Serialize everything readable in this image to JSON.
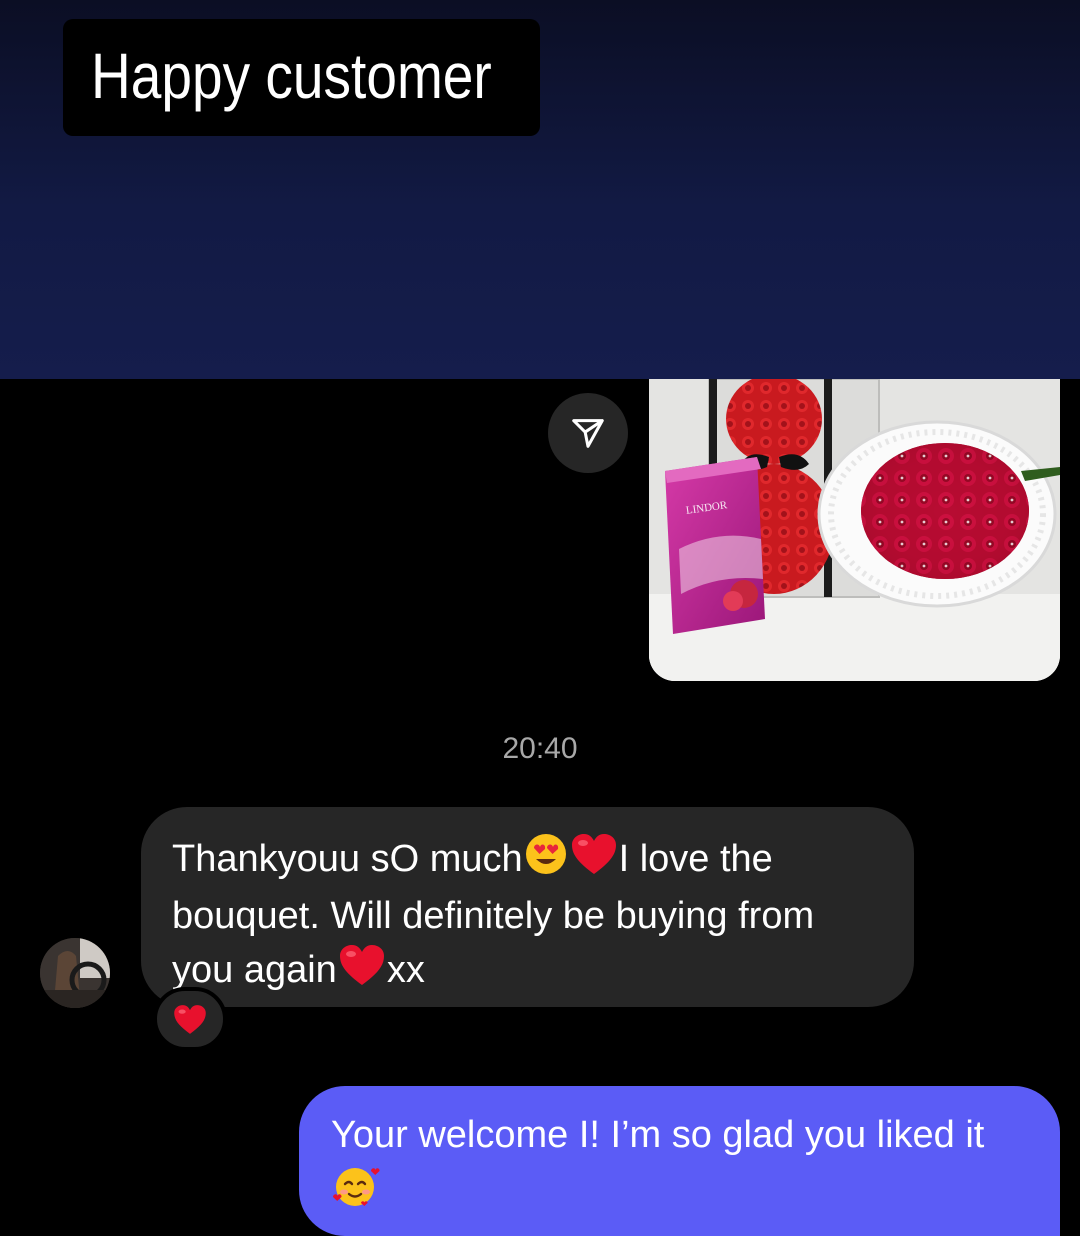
{
  "story": {
    "caption": "Happy customer"
  },
  "thread": {
    "share_icon": "paper-plane-icon",
    "photo_alt": "Red rose teddy bear, Lindt Lindor chocolate box and red rose bouquet",
    "photo_box_label": "LINDOR",
    "timestamp": "20:40"
  },
  "messages": {
    "incoming": {
      "line1_a": "Thankyouu sO much",
      "line1_b": "I love the",
      "line2": "bouquet. Will definitely be buying from",
      "line3_a": "you again",
      "line3_b": "xx",
      "reaction": "heart-emoji"
    },
    "outgoing": {
      "line1": "Your welcome I! I’m so glad you liked it",
      "emoji": "smiling-face-with-hearts-emoji"
    }
  },
  "colors": {
    "header_top": "#0b0e24",
    "header_bottom": "#151d4c",
    "incoming_bubble": "#262626",
    "outgoing_bubble": "#5b5cf6",
    "timestamp": "#a8a8a8"
  }
}
